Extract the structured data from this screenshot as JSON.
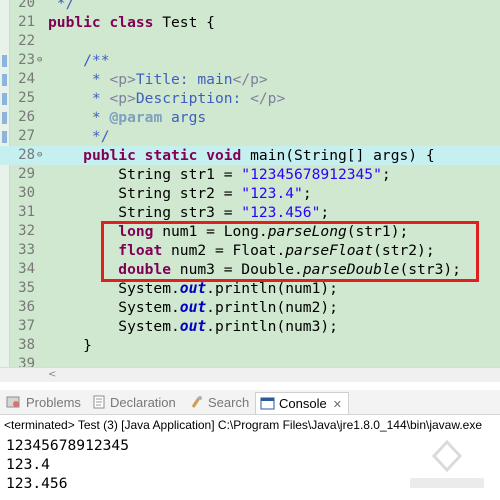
{
  "editor": {
    "lines": [
      {
        "n": "20",
        "html": "<span class=\"jd\"> */</span>"
      },
      {
        "n": "21",
        "html": "<span class=\"kw\">public</span> <span class=\"kw\">class</span> Test {"
      },
      {
        "n": "22",
        "html": ""
      },
      {
        "n": "23",
        "html": "    <span class=\"jd\">/**</span>",
        "fold": "⊖",
        "marker": true
      },
      {
        "n": "24",
        "html": "<span class=\"jd\">     * </span><span class=\"tag\">&lt;p&gt;</span><span class=\"jd\">Title: main</span><span class=\"tag\">&lt;/p&gt;</span>",
        "marker": true
      },
      {
        "n": "25",
        "html": "<span class=\"jd\">     * </span><span class=\"tag\">&lt;p&gt;</span><span class=\"jd\">Description: </span><span class=\"tag\">&lt;/p&gt;</span>",
        "marker": true
      },
      {
        "n": "26",
        "html": "<span class=\"jd\">     * </span><span class=\"ann\">@param</span><span class=\"jd\"> args</span>",
        "marker": true
      },
      {
        "n": "27",
        "html": "<span class=\"jd\">     */</span>",
        "marker": true
      },
      {
        "n": "28",
        "html": "    <span class=\"kw\">public</span> <span class=\"kw\">static</span> <span class=\"kw\">void</span> main(String[] args) {",
        "fold": "⊖",
        "highlight": true
      },
      {
        "n": "29",
        "html": "        String str1 = <span class=\"str\">\"12345678912345\"</span>;"
      },
      {
        "n": "30",
        "html": "        String str2 = <span class=\"str\">\"123.4\"</span>;"
      },
      {
        "n": "31",
        "html": "        String str3 = <span class=\"str\">\"123.456\"</span>;"
      },
      {
        "n": "32",
        "html": "        <span class=\"kw\">long</span> num1 = Long.<span class=\"it\">parseLong</span>(str1);"
      },
      {
        "n": "33",
        "html": "        <span class=\"kw\">float</span> num2 = Float.<span class=\"it\">parseFloat</span>(str2);"
      },
      {
        "n": "34",
        "html": "        <span class=\"kw\">double</span> num3 = Double.<span class=\"it\">parseDouble</span>(str3);"
      },
      {
        "n": "35",
        "html": "        System.<span class=\"fld\">out</span>.println(num1);"
      },
      {
        "n": "36",
        "html": "        System.<span class=\"fld\">out</span>.println(num2);"
      },
      {
        "n": "37",
        "html": "        System.<span class=\"fld\">out</span>.println(num3);"
      },
      {
        "n": "38",
        "html": "    }"
      },
      {
        "n": "39",
        "html": ""
      }
    ]
  },
  "tabs": {
    "problems": "Problems",
    "declaration": "Declaration",
    "search": "Search",
    "console": "Console",
    "close": "✕"
  },
  "console": {
    "status": "<terminated> Test (3) [Java Application] C:\\Program Files\\Java\\jre1.8.0_144\\bin\\javaw.exe",
    "output": [
      "12345678912345",
      "123.4",
      "123.456"
    ]
  },
  "colors": {
    "editor_bg": "#cfe8cf",
    "current_line": "#c6f0f0",
    "keyword": "#7f0055",
    "string": "#2a00ff",
    "javadoc": "#3f5fbf",
    "selection_box": "#e02020"
  }
}
